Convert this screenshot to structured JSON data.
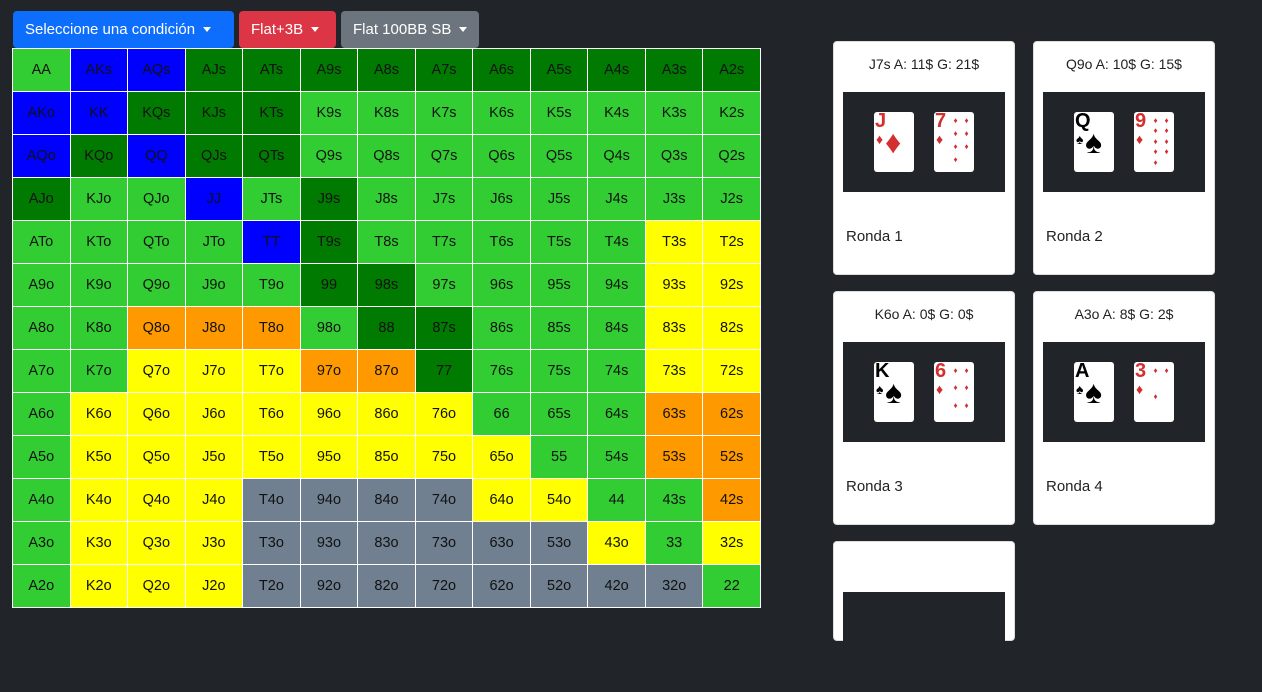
{
  "toolbar": {
    "condition": {
      "label": "Seleccione una condición",
      "color": "#0d6efd"
    },
    "action": {
      "label": "Flat+3B",
      "color": "#dc3545"
    },
    "scenario": {
      "label": "Flat 100BB SB",
      "color": "#6c757d"
    }
  },
  "legend_colors": {
    "D": "#007a00",
    "B": "#0000ff",
    "G": "#32cd32",
    "Y": "#ffff00",
    "O": "#ff9900",
    "S": "#708090"
  },
  "grid": [
    [
      [
        "AA",
        "G"
      ],
      [
        "AKs",
        "B"
      ],
      [
        "AQs",
        "B"
      ],
      [
        "AJs",
        "D"
      ],
      [
        "ATs",
        "D"
      ],
      [
        "A9s",
        "D"
      ],
      [
        "A8s",
        "D"
      ],
      [
        "A7s",
        "D"
      ],
      [
        "A6s",
        "D"
      ],
      [
        "A5s",
        "D"
      ],
      [
        "A4s",
        "D"
      ],
      [
        "A3s",
        "D"
      ],
      [
        "A2s",
        "D"
      ]
    ],
    [
      [
        "AKo",
        "B"
      ],
      [
        "KK",
        "B"
      ],
      [
        "KQs",
        "D"
      ],
      [
        "KJs",
        "D"
      ],
      [
        "KTs",
        "D"
      ],
      [
        "K9s",
        "G"
      ],
      [
        "K8s",
        "G"
      ],
      [
        "K7s",
        "G"
      ],
      [
        "K6s",
        "G"
      ],
      [
        "K5s",
        "G"
      ],
      [
        "K4s",
        "G"
      ],
      [
        "K3s",
        "G"
      ],
      [
        "K2s",
        "G"
      ]
    ],
    [
      [
        "AQo",
        "B"
      ],
      [
        "KQo",
        "D"
      ],
      [
        "QQ",
        "B"
      ],
      [
        "QJs",
        "D"
      ],
      [
        "QTs",
        "D"
      ],
      [
        "Q9s",
        "G"
      ],
      [
        "Q8s",
        "G"
      ],
      [
        "Q7s",
        "G"
      ],
      [
        "Q6s",
        "G"
      ],
      [
        "Q5s",
        "G"
      ],
      [
        "Q4s",
        "G"
      ],
      [
        "Q3s",
        "G"
      ],
      [
        "Q2s",
        "G"
      ]
    ],
    [
      [
        "AJo",
        "D"
      ],
      [
        "KJo",
        "G"
      ],
      [
        "QJo",
        "G"
      ],
      [
        "JJ",
        "B"
      ],
      [
        "JTs",
        "G"
      ],
      [
        "J9s",
        "D"
      ],
      [
        "J8s",
        "G"
      ],
      [
        "J7s",
        "G"
      ],
      [
        "J6s",
        "G"
      ],
      [
        "J5s",
        "G"
      ],
      [
        "J4s",
        "G"
      ],
      [
        "J3s",
        "G"
      ],
      [
        "J2s",
        "G"
      ]
    ],
    [
      [
        "ATo",
        "G"
      ],
      [
        "KTo",
        "G"
      ],
      [
        "QTo",
        "G"
      ],
      [
        "JTo",
        "G"
      ],
      [
        "TT",
        "B"
      ],
      [
        "T9s",
        "D"
      ],
      [
        "T8s",
        "G"
      ],
      [
        "T7s",
        "G"
      ],
      [
        "T6s",
        "G"
      ],
      [
        "T5s",
        "G"
      ],
      [
        "T4s",
        "G"
      ],
      [
        "T3s",
        "Y"
      ],
      [
        "T2s",
        "Y"
      ]
    ],
    [
      [
        "A9o",
        "G"
      ],
      [
        "K9o",
        "G"
      ],
      [
        "Q9o",
        "G"
      ],
      [
        "J9o",
        "G"
      ],
      [
        "T9o",
        "G"
      ],
      [
        "99",
        "D"
      ],
      [
        "98s",
        "D"
      ],
      [
        "97s",
        "G"
      ],
      [
        "96s",
        "G"
      ],
      [
        "95s",
        "G"
      ],
      [
        "94s",
        "G"
      ],
      [
        "93s",
        "Y"
      ],
      [
        "92s",
        "Y"
      ]
    ],
    [
      [
        "A8o",
        "G"
      ],
      [
        "K8o",
        "G"
      ],
      [
        "Q8o",
        "O"
      ],
      [
        "J8o",
        "O"
      ],
      [
        "T8o",
        "O"
      ],
      [
        "98o",
        "G"
      ],
      [
        "88",
        "D"
      ],
      [
        "87s",
        "D"
      ],
      [
        "86s",
        "G"
      ],
      [
        "85s",
        "G"
      ],
      [
        "84s",
        "G"
      ],
      [
        "83s",
        "Y"
      ],
      [
        "82s",
        "Y"
      ]
    ],
    [
      [
        "A7o",
        "G"
      ],
      [
        "K7o",
        "G"
      ],
      [
        "Q7o",
        "Y"
      ],
      [
        "J7o",
        "Y"
      ],
      [
        "T7o",
        "Y"
      ],
      [
        "97o",
        "O"
      ],
      [
        "87o",
        "O"
      ],
      [
        "77",
        "D"
      ],
      [
        "76s",
        "G"
      ],
      [
        "75s",
        "G"
      ],
      [
        "74s",
        "G"
      ],
      [
        "73s",
        "Y"
      ],
      [
        "72s",
        "Y"
      ]
    ],
    [
      [
        "A6o",
        "G"
      ],
      [
        "K6o",
        "Y"
      ],
      [
        "Q6o",
        "Y"
      ],
      [
        "J6o",
        "Y"
      ],
      [
        "T6o",
        "Y"
      ],
      [
        "96o",
        "Y"
      ],
      [
        "86o",
        "Y"
      ],
      [
        "76o",
        "Y"
      ],
      [
        "66",
        "G"
      ],
      [
        "65s",
        "G"
      ],
      [
        "64s",
        "G"
      ],
      [
        "63s",
        "O"
      ],
      [
        "62s",
        "O"
      ]
    ],
    [
      [
        "A5o",
        "G"
      ],
      [
        "K5o",
        "Y"
      ],
      [
        "Q5o",
        "Y"
      ],
      [
        "J5o",
        "Y"
      ],
      [
        "T5o",
        "Y"
      ],
      [
        "95o",
        "Y"
      ],
      [
        "85o",
        "Y"
      ],
      [
        "75o",
        "Y"
      ],
      [
        "65o",
        "Y"
      ],
      [
        "55",
        "G"
      ],
      [
        "54s",
        "G"
      ],
      [
        "53s",
        "O"
      ],
      [
        "52s",
        "O"
      ]
    ],
    [
      [
        "A4o",
        "G"
      ],
      [
        "K4o",
        "Y"
      ],
      [
        "Q4o",
        "Y"
      ],
      [
        "J4o",
        "Y"
      ],
      [
        "T4o",
        "S"
      ],
      [
        "94o",
        "S"
      ],
      [
        "84o",
        "S"
      ],
      [
        "74o",
        "S"
      ],
      [
        "64o",
        "Y"
      ],
      [
        "54o",
        "Y"
      ],
      [
        "44",
        "G"
      ],
      [
        "43s",
        "G"
      ],
      [
        "42s",
        "O"
      ]
    ],
    [
      [
        "A3o",
        "G"
      ],
      [
        "K3o",
        "Y"
      ],
      [
        "Q3o",
        "Y"
      ],
      [
        "J3o",
        "Y"
      ],
      [
        "T3o",
        "S"
      ],
      [
        "93o",
        "S"
      ],
      [
        "83o",
        "S"
      ],
      [
        "73o",
        "S"
      ],
      [
        "63o",
        "S"
      ],
      [
        "53o",
        "S"
      ],
      [
        "43o",
        "Y"
      ],
      [
        "33",
        "G"
      ],
      [
        "32s",
        "Y"
      ]
    ],
    [
      [
        "A2o",
        "G"
      ],
      [
        "K2o",
        "Y"
      ],
      [
        "Q2o",
        "Y"
      ],
      [
        "J2o",
        "Y"
      ],
      [
        "T2o",
        "S"
      ],
      [
        "92o",
        "S"
      ],
      [
        "82o",
        "S"
      ],
      [
        "72o",
        "S"
      ],
      [
        "62o",
        "S"
      ],
      [
        "52o",
        "S"
      ],
      [
        "42o",
        "S"
      ],
      [
        "32o",
        "S"
      ],
      [
        "22",
        "G"
      ]
    ]
  ],
  "hands": [
    {
      "title": "J7s A: 11$ G: 21$",
      "round": "Ronda 1",
      "cards": [
        {
          "rank": "J",
          "suit": "♦",
          "color": "#d32f2f"
        },
        {
          "rank": "7",
          "suit": "♦",
          "color": "#d32f2f"
        }
      ]
    },
    {
      "title": "Q9o A: 10$ G: 15$",
      "round": "Ronda 2",
      "cards": [
        {
          "rank": "Q",
          "suit": "♠",
          "color": "#000000"
        },
        {
          "rank": "9",
          "suit": "♦",
          "color": "#d32f2f"
        }
      ]
    },
    {
      "title": "K6o A: 0$ G: 0$",
      "round": "Ronda 3",
      "cards": [
        {
          "rank": "K",
          "suit": "♠",
          "color": "#000000"
        },
        {
          "rank": "6",
          "suit": "♦",
          "color": "#d32f2f"
        }
      ]
    },
    {
      "title": "A3o A: 8$ G: 2$",
      "round": "Ronda 4",
      "cards": [
        {
          "rank": "A",
          "suit": "♠",
          "color": "#000000"
        },
        {
          "rank": "3",
          "suit": "♦",
          "color": "#d32f2f"
        }
      ]
    }
  ]
}
